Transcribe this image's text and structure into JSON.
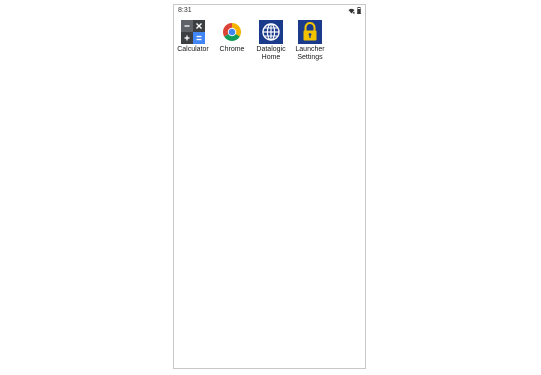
{
  "status_bar": {
    "time": "8:31",
    "icons": [
      "wifi-icon",
      "battery-icon"
    ]
  },
  "apps": [
    {
      "label": "Calculator",
      "icon": "calculator-icon"
    },
    {
      "label": "Chrome",
      "icon": "chrome-icon"
    },
    {
      "label": "Datalogic\nHome",
      "icon": "globe-icon"
    },
    {
      "label": "Launcher\nSettings",
      "icon": "lock-icon"
    }
  ],
  "colors": {
    "calculator_dark": "#5f6368",
    "calculator_blue": "#4285f4",
    "datalogic_blue": "#1a3a8c",
    "launcher_yellow": "#f2c400",
    "chrome_red": "#db4437",
    "chrome_yellow": "#f4b400",
    "chrome_green": "#0f9d58",
    "chrome_blue": "#4285f4"
  }
}
